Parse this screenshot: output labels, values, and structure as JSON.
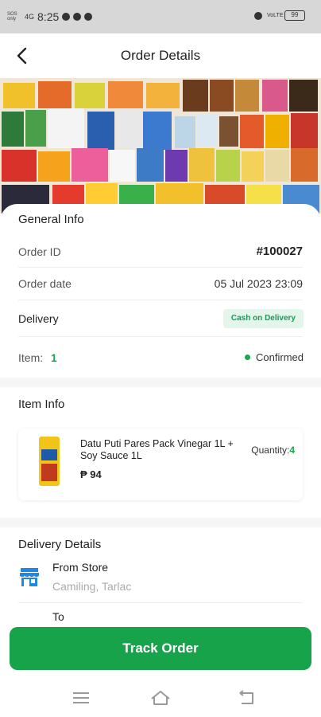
{
  "status_bar": {
    "carrier": "SOS only",
    "network": "4G",
    "time": "8:25",
    "battery": "99",
    "icons": [
      "messenger-icon",
      "vpn-icon",
      "alarm-icon",
      "volte-icon",
      "battery-icon"
    ]
  },
  "header": {
    "title": "Order Details",
    "back_icon": "back-arrow-icon"
  },
  "banner": {
    "description": "product-collage-image"
  },
  "general_info": {
    "title": "General Info",
    "order_id_label": "Order ID",
    "order_id_value": "#100027",
    "order_date_label": "Order date",
    "order_date_value": "05 Jul 2023  23:09",
    "delivery_label": "Delivery",
    "delivery_badge": "Cash on Delivery",
    "item_label": "Item:",
    "item_count": "1",
    "status": "Confirmed"
  },
  "item_info": {
    "title": "Item Info",
    "items": [
      {
        "name": "Datu Puti Pares Pack Vinegar 1L + Soy Sauce 1L",
        "price": "₱ 94",
        "quantity_label": "Quantity:",
        "quantity": "4"
      }
    ]
  },
  "delivery_details": {
    "title": "Delivery Details",
    "from_label": "From Store",
    "from_address": "Camiling, Tarlac",
    "to_label": "To"
  },
  "actions": {
    "track_order": "Track Order"
  },
  "colors": {
    "accent": "#16a34a",
    "badge_bg": "#e4f5ec",
    "store_icon": "#1e88e5"
  }
}
